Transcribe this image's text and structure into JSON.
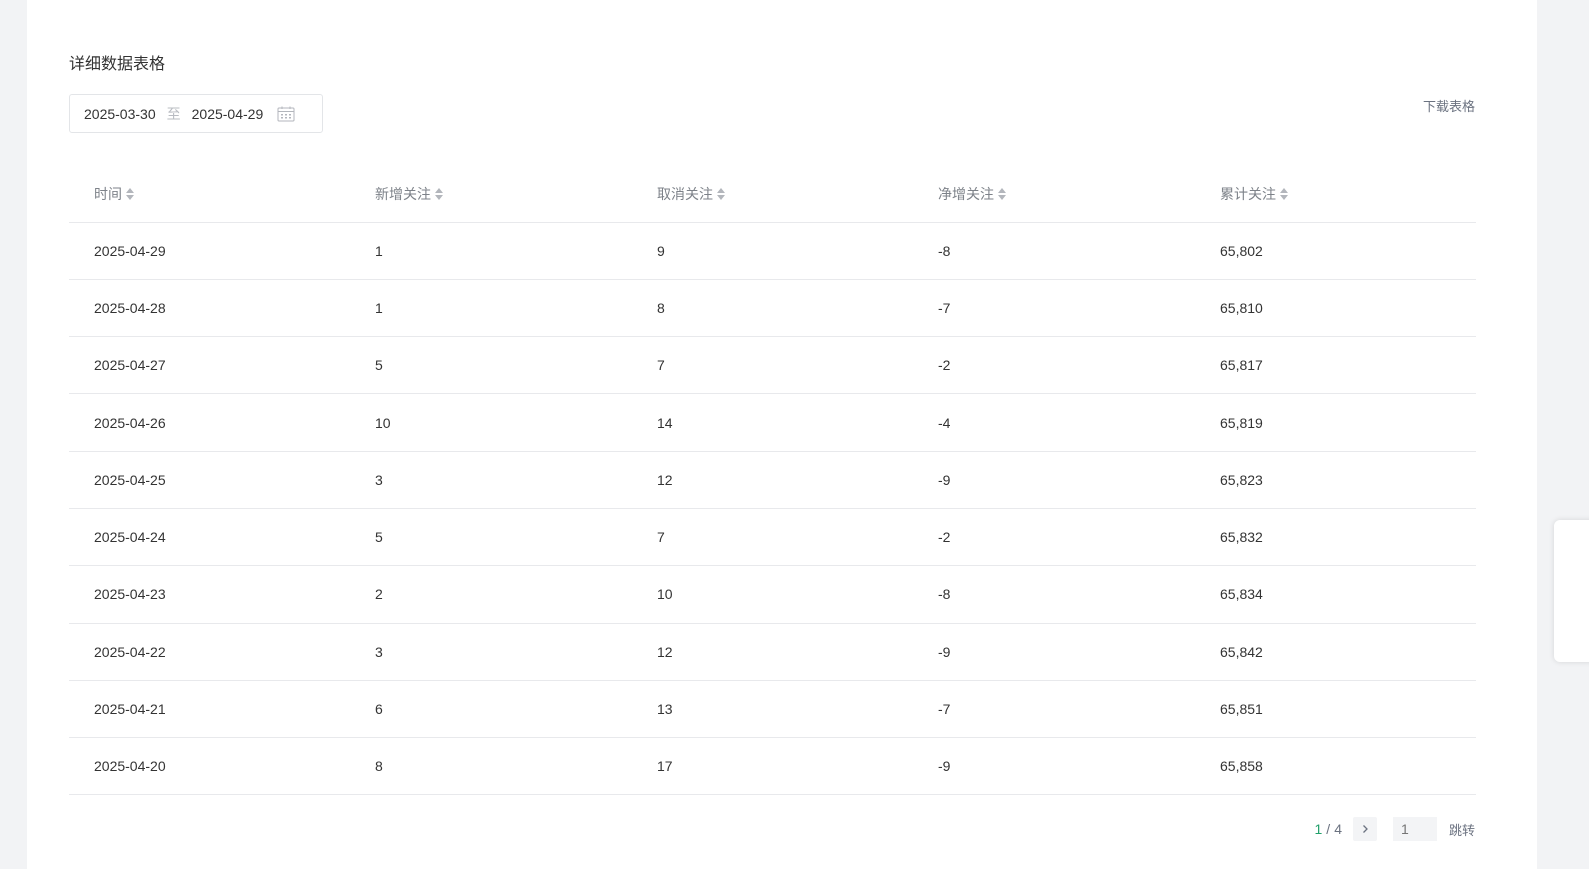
{
  "section": {
    "title": "详细数据表格"
  },
  "date_range": {
    "start": "2025-03-30",
    "separator": "至",
    "end": "2025-04-29"
  },
  "download_label": "下载表格",
  "table": {
    "headers": [
      "时间",
      "新增关注",
      "取消关注",
      "净增关注",
      "累计关注"
    ],
    "rows": [
      [
        "2025-04-29",
        "1",
        "9",
        "-8",
        "65,802"
      ],
      [
        "2025-04-28",
        "1",
        "8",
        "-7",
        "65,810"
      ],
      [
        "2025-04-27",
        "5",
        "7",
        "-2",
        "65,817"
      ],
      [
        "2025-04-26",
        "10",
        "14",
        "-4",
        "65,819"
      ],
      [
        "2025-04-25",
        "3",
        "12",
        "-9",
        "65,823"
      ],
      [
        "2025-04-24",
        "5",
        "7",
        "-2",
        "65,832"
      ],
      [
        "2025-04-23",
        "2",
        "10",
        "-8",
        "65,834"
      ],
      [
        "2025-04-22",
        "3",
        "12",
        "-9",
        "65,842"
      ],
      [
        "2025-04-21",
        "6",
        "13",
        "-7",
        "65,851"
      ],
      [
        "2025-04-20",
        "8",
        "17",
        "-9",
        "65,858"
      ]
    ]
  },
  "pagination": {
    "current": "1",
    "separator": "/",
    "total": "4",
    "jump_placeholder": "1",
    "jump_label": "跳转"
  },
  "colors": {
    "accent": "#22a06b",
    "background": "#f2f3f5"
  }
}
